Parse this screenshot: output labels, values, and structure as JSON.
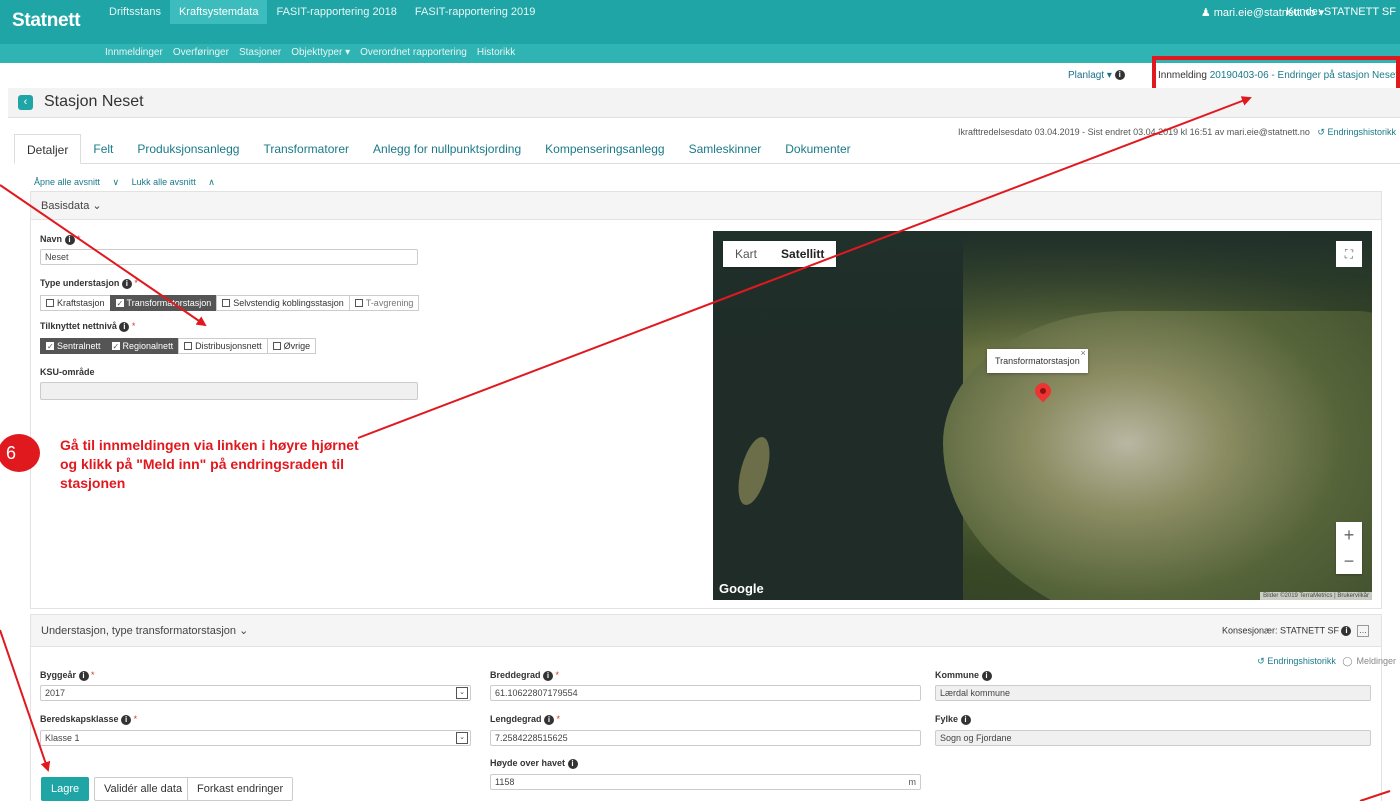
{
  "header": {
    "brand": "Statnett",
    "nav": [
      "Driftsstans",
      "Kraftsystemdata",
      "FASIT-rapportering 2018",
      "FASIT-rapportering 2019"
    ],
    "active_nav": "Kraftsystemdata",
    "user": "mari.eie@statnett.no",
    "customer": "Kunde: STATNETT SF"
  },
  "subnav": [
    "Innmeldinger",
    "Overføringer",
    "Stasjoner",
    "Objekttyper ▾",
    "Overordnet rapportering",
    "Historikk"
  ],
  "planlagt": "Planlagt",
  "innmelding": {
    "label": "Innmelding",
    "link": "20190403-06 - Endringer på stasjon Neset"
  },
  "page": {
    "title": "Stasjon Neset"
  },
  "meta": {
    "text": "Ikrafttredelsesdato 03.04.2019 - Sist endret 03.04.2019 kl 16:51 av mari.eie@statnett.no",
    "history": "Endringshistorikk"
  },
  "tabs": [
    "Detaljer",
    "Felt",
    "Produksjonsanlegg",
    "Transformatorer",
    "Anlegg for nullpunktsjording",
    "Kompenseringsanlegg",
    "Samleskinner",
    "Dokumenter"
  ],
  "toggles": {
    "open_all": "Åpne alle avsnitt",
    "close_all": "Lukk alle avsnitt"
  },
  "basisdata": {
    "heading": "Basisdata",
    "name_label": "Navn",
    "name_value": "Neset",
    "type_label": "Type understasjon",
    "type_options": [
      {
        "label": "Kraftstasjon",
        "on": false
      },
      {
        "label": "Transformatorstasjon",
        "on": true
      },
      {
        "label": "Selvstendig koblingsstasjon",
        "on": false
      },
      {
        "label": "T-avgrening",
        "on": false
      }
    ],
    "net_label": "Tilknyttet nettnivå",
    "net_options": [
      {
        "label": "Sentralnett",
        "on": true
      },
      {
        "label": "Regionalnett",
        "on": true
      },
      {
        "label": "Distribusjonsnett",
        "on": false
      },
      {
        "label": "Øvrige",
        "on": false
      }
    ],
    "ksu_label": "KSU-område",
    "ksu_value": ""
  },
  "map": {
    "tab_map": "Kart",
    "tab_satellite": "Satellitt",
    "marker_label": "Transformatorstasjon",
    "logo": "Google",
    "credits": "Bilder ©2019 TerraMetrics | Brukervilkår"
  },
  "instruction": {
    "step": "6",
    "text": "Gå til innmeldingen via linken i høyre hjørnet og klikk på \"Meld inn\" på endringsraden til stasjonen"
  },
  "understasjon": {
    "heading": "Understasjon, type transformatorstasjon",
    "konsesjonar": "Konsesjonær: STATNETT SF",
    "history": "Endringshistorikk",
    "messages": "Meldinger",
    "byggear_label": "Byggeår",
    "byggear_value": "2017",
    "beredskap_label": "Beredskapsklasse",
    "beredskap_value": "Klasse 1",
    "bredde_label": "Breddegrad",
    "bredde_value": "61.10622807179554",
    "lengde_label": "Lengdegrad",
    "lengde_value": "7.2584228515625",
    "hoyde_label": "Høyde over havet",
    "hoyde_value": "1158",
    "hoyde_unit": "m",
    "kommune_label": "Kommune",
    "kommune_value": "Lærdal kommune",
    "fylke_label": "Fylke",
    "fylke_value": "Sogn og Fjordane"
  },
  "buttons": {
    "save": "Lagre",
    "validate": "Validér alle data",
    "discard": "Forkast endringer"
  }
}
